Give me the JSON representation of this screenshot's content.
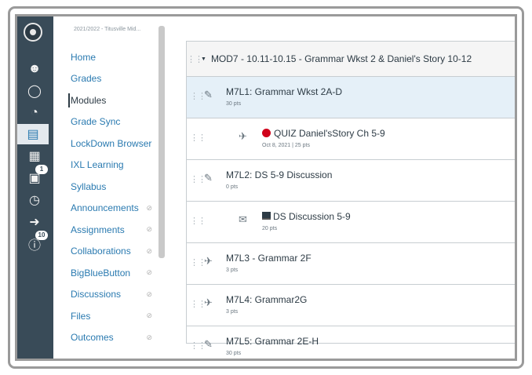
{
  "global_nav": {
    "icons": [
      "canvas-logo",
      "account-icon",
      "admin-icon",
      "dashboard-icon",
      "courses-icon",
      "calendar-icon",
      "inbox-icon",
      "history-icon",
      "logout-icon",
      "help-icon"
    ],
    "inbox_badge": "1",
    "help_badge": "10"
  },
  "course_nav": {
    "term": "2021/2022 - Titusville Mid...",
    "items": [
      {
        "label": "Home",
        "hidden": false
      },
      {
        "label": "Grades",
        "hidden": false
      },
      {
        "label": "Modules",
        "hidden": false,
        "active": true
      },
      {
        "label": "Grade Sync",
        "hidden": false
      },
      {
        "label": "LockDown Browser",
        "hidden": false
      },
      {
        "label": "IXL Learning",
        "hidden": false
      },
      {
        "label": "Syllabus",
        "hidden": false
      },
      {
        "label": "Announcements",
        "hidden": true
      },
      {
        "label": "Assignments",
        "hidden": true
      },
      {
        "label": "Collaborations",
        "hidden": true
      },
      {
        "label": "BigBlueButton",
        "hidden": true
      },
      {
        "label": "Discussions",
        "hidden": true
      },
      {
        "label": "Files",
        "hidden": true
      },
      {
        "label": "Outcomes",
        "hidden": true
      }
    ]
  },
  "module": {
    "title": "MOD7 - 10.11-10.15 - Grammar Wkst 2 & Daniel's Story 10-12",
    "items": [
      {
        "title": "M7L1: Grammar Wkst 2A-D",
        "meta": "30 pts",
        "icon": "assignment-icon"
      },
      {
        "title": "QUIZ Daniel'sStory Ch 5-9",
        "meta": "Oct 8, 2021  |  25 pts",
        "icon": "quiz-icon"
      },
      {
        "title": "M7L2: DS 5-9 Discussion",
        "meta": "0 pts",
        "icon": "assignment-icon"
      },
      {
        "title": "DS Discussion 5-9",
        "meta": "20 pts",
        "icon": "discussion-icon"
      },
      {
        "title": "M7L3 - Grammar 2F",
        "meta": "3 pts",
        "icon": "quiz-icon"
      },
      {
        "title": "M7L4: Grammar2G",
        "meta": "3 pts",
        "icon": "quiz-icon"
      },
      {
        "title": "M7L5: Grammar 2E-H",
        "meta": "30 pts",
        "icon": "assignment-icon"
      }
    ]
  }
}
